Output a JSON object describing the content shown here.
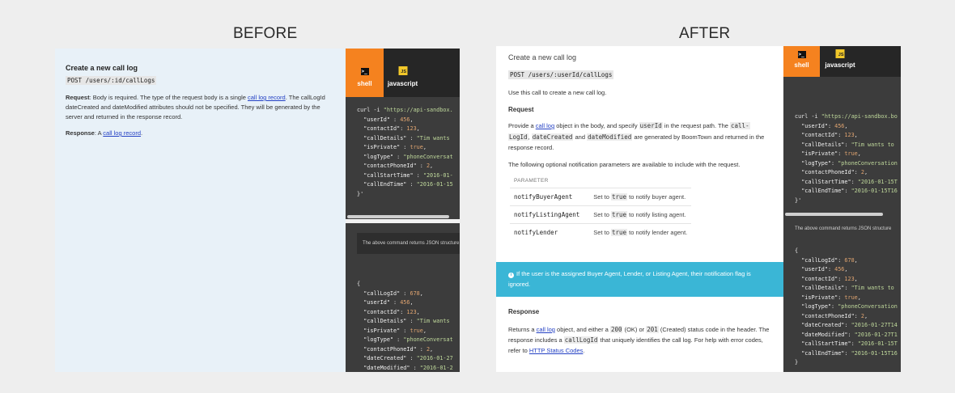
{
  "labels": {
    "before": "BEFORE",
    "after": "AFTER"
  },
  "before": {
    "title": "Create a new call log",
    "endpoint": "POST /users/:id/callLogs",
    "request_label": "Request",
    "request_text_1": ": Body is required. The type of the request body is a single ",
    "request_link": "call log record",
    "request_text_2": ". The callLogId dateCreated and dateModified attributes should not be specified. They will be generated by the server and returned in the response record.",
    "response_label": "Response",
    "response_text": ": A ",
    "response_link": "call log record",
    "response_end": ".",
    "tabs": [
      {
        "label": "shell",
        "icon": "terminal-icon",
        "icon_text": ">_"
      },
      {
        "label": "javascript",
        "icon": "js-icon",
        "icon_text": "JS"
      }
    ],
    "note": "The above command returns JSON structure"
  },
  "after": {
    "title": "Create a new call log",
    "endpoint": "POST /users/:userId/callLogs",
    "intro": "Use this call to create a new call log.",
    "request_heading": "Request",
    "provide_1": "Provide a ",
    "provide_link": "call log",
    "provide_2": " object in the body, and specify ",
    "provide_code_1": "userId",
    "provide_3": " in the request path. The ",
    "provide_code_2": "call-",
    "provide_code_2b": "LogId",
    "provide_4": ", ",
    "provide_code_3": "dateCreated",
    "provide_5": " and ",
    "provide_code_4": "dateModified",
    "provide_6": " are generated by BoomTown and returned in the response record.",
    "optional_text": "The following optional notification parameters are available to include with the request.",
    "param_header": "PARAMETER",
    "params": [
      {
        "name": "notifyBuyerAgent",
        "pre": "Set to ",
        "code": "true",
        "post": " to notify buyer agent."
      },
      {
        "name": "notifyListingAgent",
        "pre": "Set to ",
        "code": "true",
        "post": " to notify listing agent."
      },
      {
        "name": "notifyLender",
        "pre": "Set to ",
        "code": "true",
        "post": " to notify lender agent."
      }
    ],
    "info_icon": "i",
    "info_text": "If the user is the assigned Buyer Agent, Lender, or Listing Agent, their notification flag is ignored.",
    "response_heading": "Response",
    "resp_1": "Returns a ",
    "resp_link": "call log",
    "resp_2": " object, and either a ",
    "resp_code_1": "200",
    "resp_3": " (OK) or ",
    "resp_code_2": "201",
    "resp_4": " (Created) status code in the header. The response includes a ",
    "resp_code_3": "callLogId",
    "resp_5": " that uniquely identifies the call log. For help with error codes, refer to ",
    "resp_link_2": "HTTP Status Codes",
    "resp_6": ".",
    "tabs": [
      {
        "label": "shell",
        "icon": "terminal-icon",
        "icon_text": ">_"
      },
      {
        "label": "javascript",
        "icon": "js-icon",
        "icon_text": "JS"
      }
    ],
    "note": "The above command returns JSON structure"
  },
  "code": {
    "request_before": [
      "curl -i \"https://api-sandbox.",
      "  \"userId\" : 456,",
      "  \"contactId\": 123,",
      "  \"callDetails\" : \"Tim wants",
      "  \"isPrivate\" : true,",
      "  \"logType\" : \"phoneConversat",
      "  \"contactPhoneId\" : 2,",
      "  \"callStartTime\" : \"2016-01-",
      "  \"callEndTime\" : \"2016-01-15",
      "}'"
    ],
    "response_before": [
      "{",
      "  \"callLogId\" : 678,",
      "  \"userId\" : 456,",
      "  \"contactId\": 123,",
      "  \"callDetails\" : \"Tim wants",
      "  \"isPrivate\" : true,",
      "  \"logType\" : \"phoneConversat",
      "  \"contactPhoneId\" : 2,",
      "  \"dateCreated\" : \"2016-01-27",
      "  \"dateModified\" : \"2016-01-2"
    ],
    "request_after": [
      "curl -i \"https://api-sandbox.bo",
      "  \"userId\": 456,",
      "  \"contactId\": 123,",
      "  \"callDetails\": \"Tim wants to",
      "  \"isPrivate\": true,",
      "  \"logType\": \"phoneConversation",
      "  \"contactPhoneId\": 2,",
      "  \"callStartTime\": \"2016-01-15T",
      "  \"callEndTime\": \"2016-01-15T16",
      "}'"
    ],
    "response_after": [
      "{",
      "  \"callLogId\": 678,",
      "  \"userId\": 456,",
      "  \"contactId\": 123,",
      "  \"callDetails\": \"Tim wants to",
      "  \"isPrivate\": true,",
      "  \"logType\": \"phoneConversation",
      "  \"contactPhoneId\": 2,",
      "  \"dateCreated\": \"2016-01-27T14",
      "  \"dateModified\": \"2016-01-27T1",
      "  \"callStartTime\": \"2016-01-15T",
      "  \"callEndTime\": \"2016-01-15T16",
      "}"
    ]
  },
  "colors": {
    "accent_tab": "#f5821f",
    "info_bg": "#3ab6d6",
    "link": "#2441c4",
    "code_bg": "#3c3c3c"
  }
}
